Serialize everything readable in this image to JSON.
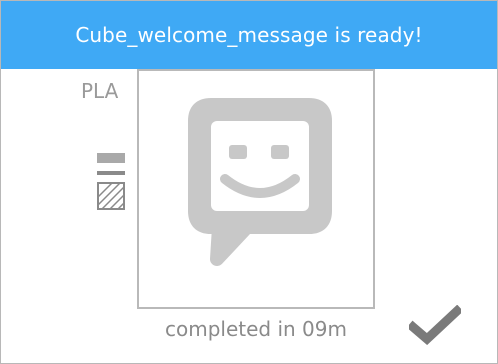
{
  "header": {
    "title": "Cube_welcome_message is ready!"
  },
  "material": {
    "label": "PLA"
  },
  "status": {
    "completed_text": "completed in 09m"
  },
  "icons": {
    "filament": "filament-layers-icon",
    "thumbnail": "smiley-speech-bubble-icon",
    "done": "checkmark-icon"
  },
  "colors": {
    "header_bg": "#3fa9f5",
    "header_text": "#ffffff",
    "icon_gray": "#c4c4c4",
    "text_gray": "#8a8a8a"
  }
}
